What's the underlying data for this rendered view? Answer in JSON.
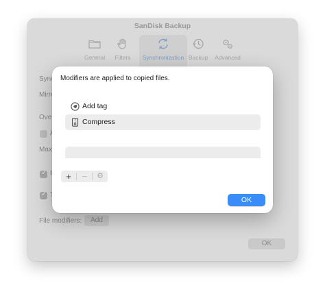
{
  "window": {
    "title": "SanDisk Backup",
    "toolbar": [
      {
        "label": "General",
        "icon": "folder-icon"
      },
      {
        "label": "Filters",
        "icon": "hand-icon"
      },
      {
        "label": "Synchronization",
        "icon": "sync-icon",
        "selected": true
      },
      {
        "label": "Backup",
        "icon": "clock-icon"
      },
      {
        "label": "Advanced",
        "icon": "gears-icon"
      }
    ],
    "partial_labels": [
      "Sync",
      "Mirro",
      "Over",
      "A",
      "Max",
      "F",
      "T"
    ],
    "file_modifiers_label": "File modifiers:",
    "add_button": "Add",
    "ok_button": "OK"
  },
  "sheet": {
    "message": "Modifiers are applied to copied files.",
    "modifiers": [
      {
        "label": "Add tag",
        "icon": "tag-icon",
        "selected": false
      },
      {
        "label": "Compress",
        "icon": "zip-icon",
        "selected": true
      }
    ],
    "add_symbol": "+",
    "remove_symbol": "−",
    "action_symbol": "⚙",
    "ok_button": "OK",
    "accent_color": "#3a8df7"
  }
}
